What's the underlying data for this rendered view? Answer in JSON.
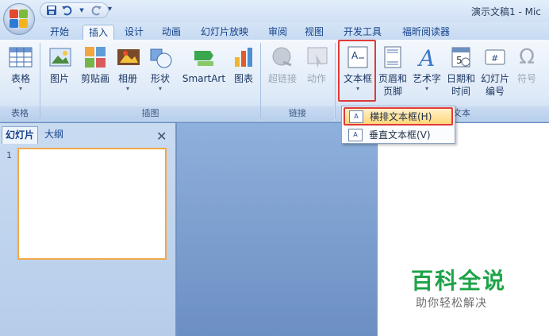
{
  "window": {
    "title": "演示文稿1 - Mic"
  },
  "tabs": [
    "开始",
    "插入",
    "设计",
    "动画",
    "幻灯片放映",
    "审阅",
    "视图",
    "开发工具",
    "福昕阅读器"
  ],
  "ribbon": {
    "table": {
      "label": "表格",
      "group": "表格"
    },
    "illustrations": {
      "group": "插图",
      "picture": "图片",
      "clipart": "剪贴画",
      "album": "相册",
      "shapes": "形状",
      "smartart": "SmartArt",
      "chart": "图表"
    },
    "links": {
      "group": "链接",
      "hyperlink": "超链接",
      "action": "动作"
    },
    "text": {
      "textbox": "文本框",
      "header_footer_1": "页眉和",
      "header_footer_2": "页脚",
      "wordart": "艺术字",
      "datetime_1": "日期和",
      "datetime_2": "时间",
      "slidenum_1": "幻灯片",
      "slidenum_2": "编号",
      "symbol": "符号",
      "group_partial": "文本"
    }
  },
  "dropdown": {
    "items": [
      {
        "label": "横排文本框(H)"
      },
      {
        "label": "垂直文本框(V)"
      }
    ]
  },
  "pane": {
    "tab_slides": "幻灯片",
    "tab_outline": "大纲",
    "close": "✕",
    "slide_number": "1"
  },
  "watermark": {
    "title": "百科全说",
    "subtitle": "助你轻松解决"
  },
  "colors": {
    "highlight": "#e03a3a",
    "watermark_green": "#1fa34a"
  }
}
